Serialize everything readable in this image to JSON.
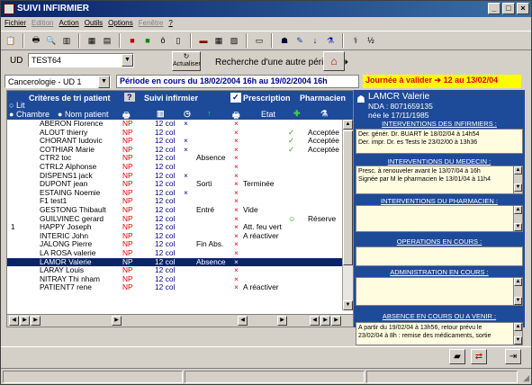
{
  "window": {
    "title": "SUIVI INFIRMIER"
  },
  "menu": [
    "Fichier",
    "Edition",
    "Action",
    "Outils",
    "Options",
    "Fenêtre",
    "?"
  ],
  "menu_disabled": [
    false,
    true,
    false,
    false,
    false,
    true,
    false
  ],
  "toolbar_icons": [
    "list-icon",
    "print-icon",
    "print-preview-icon",
    "columns-icon",
    "grid-icon",
    "table-icon",
    "book-red-icon",
    "book-green-icon",
    "bag-icon",
    "bottle-icon",
    "bed-icon",
    "calendar-icon",
    "chart-icon",
    "monitor-icon",
    "nurse-icon",
    "pill-icon",
    "tube-icon",
    "pill-bottle-icon",
    "drink-icon",
    "stethoscope-icon",
    "counter-icon"
  ],
  "ud": {
    "label": "UD",
    "value": "TEST64"
  },
  "service": {
    "value": "Cancerologie - UD 1"
  },
  "update_button": {
    "label": "Actualiser"
  },
  "search": {
    "label": "Recherche d'une autre période"
  },
  "period": {
    "text": "Période en cours du 18/02/2004 16h au 19/02/2004 16h"
  },
  "to_validate": {
    "text": "Journée à valider ➔ 12 au 13/02/04"
  },
  "grid": {
    "header": {
      "sort_title": "Critères de tri patient",
      "help": "?",
      "opt_lit": "Lit",
      "opt_room": "Chambre",
      "opt_name": "Nom patient",
      "nursing": "Suivi infirmier",
      "prescription": "Prescription",
      "pharmacy": "Pharmacien",
      "state": "Etat"
    },
    "rows": [
      {
        "bed": "",
        "name": "ABERON Florence",
        "np": "NP",
        "col": "12 col",
        "x1": "×",
        "pres": "",
        "etat": "",
        "chk": "",
        "pharm": ""
      },
      {
        "bed": "",
        "name": "ALOUT thierry",
        "np": "NP",
        "col": "12 col",
        "x1": "",
        "pres": "",
        "etat": "",
        "chk": "✓",
        "pharm": "Acceptée"
      },
      {
        "bed": "",
        "name": "CHORANT ludovic",
        "np": "NP",
        "col": "12 col",
        "x1": "×",
        "pres": "",
        "etat": "",
        "chk": "✓",
        "pharm": "Acceptée"
      },
      {
        "bed": "",
        "name": "COTHIAR Marie",
        "np": "NP",
        "col": "12 col",
        "x1": "×",
        "pres": "",
        "etat": "",
        "chk": "✓",
        "pharm": "Acceptée"
      },
      {
        "bed": "",
        "name": "CTR2 toc",
        "np": "NP",
        "col": "12 col",
        "x1": "",
        "pres": "Absence",
        "etat": "",
        "chk": "",
        "pharm": ""
      },
      {
        "bed": "",
        "name": "CTRL2 Alphonse",
        "np": "NP",
        "col": "12 col",
        "x1": "",
        "pres": "",
        "etat": "",
        "chk": "",
        "pharm": ""
      },
      {
        "bed": "",
        "name": "DISPENS1 jack",
        "np": "NP",
        "col": "12 col",
        "x1": "×",
        "pres": "",
        "etat": "",
        "chk": "",
        "pharm": ""
      },
      {
        "bed": "",
        "name": "DUPONT jean",
        "np": "NP",
        "col": "12 col",
        "x1": "",
        "pres": "Sorti",
        "etat": "Terminée",
        "chk": "",
        "pharm": ""
      },
      {
        "bed": "",
        "name": "ESTAING Noemie",
        "np": "NP",
        "col": "12 col",
        "x1": "×",
        "pres": "",
        "etat": "",
        "chk": "",
        "pharm": ""
      },
      {
        "bed": "",
        "name": "F1 test1",
        "np": "NP",
        "col": "12 col",
        "x1": "",
        "pres": "",
        "etat": "",
        "chk": "",
        "pharm": ""
      },
      {
        "bed": "",
        "name": "GESTONG Thibault",
        "np": "NP",
        "col": "12 col",
        "x1": "",
        "pres": "Entré",
        "etat": "Vide",
        "chk": "",
        "pharm": ""
      },
      {
        "bed": "",
        "name": "GUILVINEC gerard",
        "np": "NP",
        "col": "12 col",
        "x1": "",
        "pres": "",
        "etat": "",
        "chk": "☺",
        "pharm": "Réserve"
      },
      {
        "bed": "1",
        "name": "HAPPY Joseph",
        "np": "NP",
        "col": "12 col",
        "x1": "",
        "pres": "",
        "etat": "Att. feu vert",
        "chk": "",
        "pharm": ""
      },
      {
        "bed": "",
        "name": "INTERIC John",
        "np": "NP",
        "col": "12 col",
        "x1": "",
        "pres": "",
        "etat": "A réactiver",
        "chk": "",
        "pharm": ""
      },
      {
        "bed": "",
        "name": "JALONG Pierre",
        "np": "NP",
        "col": "12 col",
        "x1": "",
        "pres": "Fin Abs.",
        "etat": "",
        "chk": "",
        "pharm": ""
      },
      {
        "bed": "",
        "name": "LA ROSA valerie",
        "np": "NP",
        "col": "12 col",
        "x1": "",
        "pres": "",
        "etat": "",
        "chk": "",
        "pharm": ""
      },
      {
        "bed": "",
        "name": "LAMOR Valerie",
        "np": "NP",
        "col": "12 col",
        "x1": "",
        "pres": "Absence",
        "etat": "",
        "chk": "",
        "pharm": "",
        "sel": true
      },
      {
        "bed": "",
        "name": "LARAY Louis",
        "np": "NP",
        "col": "12 col",
        "x1": "",
        "pres": "",
        "etat": "",
        "chk": "",
        "pharm": ""
      },
      {
        "bed": "",
        "name": "NITRAY Thi nham",
        "np": "NP",
        "col": "12 col",
        "x1": "",
        "pres": "",
        "etat": "",
        "chk": "",
        "pharm": ""
      },
      {
        "bed": "",
        "name": "PATIENT7 rene",
        "np": "NP",
        "col": "12 col",
        "x1": "",
        "pres": "",
        "etat": "A réactiver",
        "chk": "",
        "pharm": ""
      }
    ]
  },
  "patient": {
    "name": "LAMCR Valerie",
    "nda": "NDA : 8071659135",
    "born": "née le 17/11/1985"
  },
  "sections": {
    "nurse_title": "INTERVENTIONS DES INFIRMIERS :",
    "nurse_lines": [
      "Der. génér. Dr. BUART le 18/02/04 à 14h54",
      "Der. impr. Dr. es Tests le 23/02/00 à 13h36"
    ],
    "doctor_title": "INTERVENTIONS DU MEDECIN :",
    "doctor_lines": [
      "Presc. à renouveler avant le 13/07/04 à 16h",
      "Signée par M le pharmacien le 13/01/04 à 11h4"
    ],
    "pharm_title": "INTERVENTIONS DU PHARMACIEN :",
    "ops_title": "OPERATIONS EN COURS :",
    "admin_title": "ADMINISTRATION EN COURS :",
    "absence_title": "ABSENCE EN COURS OU A VENIR :",
    "absence_lines": [
      "A partir du 19/02/04 à 13h56, retour prévu le",
      "23/02/04 à 8h : remise des médicaments, sortie"
    ]
  }
}
